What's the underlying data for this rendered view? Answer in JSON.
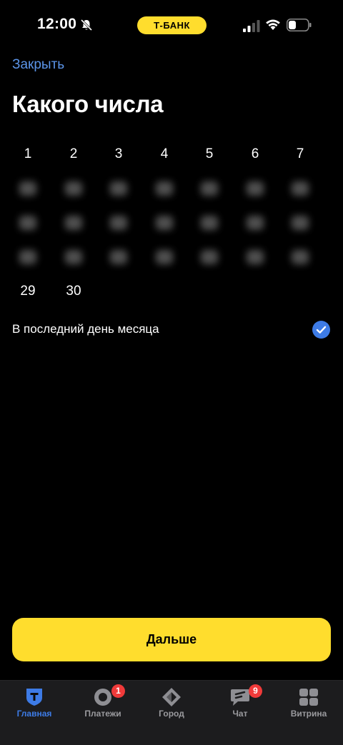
{
  "status_bar": {
    "time": "12:00",
    "carrier": "Т-БАНК",
    "carrier_color": "#ffdd2d"
  },
  "header": {
    "close_label": "Закрыть",
    "title": "Какого числа"
  },
  "calendar": {
    "rows": [
      [
        "1",
        "2",
        "3",
        "4",
        "5",
        "6",
        "7"
      ],
      [
        "",
        "",
        "",
        "",
        "",
        "",
        ""
      ],
      [
        "",
        "",
        "",
        "",
        "",
        "",
        ""
      ],
      [
        "",
        "",
        "",
        "",
        "",
        "",
        ""
      ],
      [
        "29",
        "30"
      ]
    ]
  },
  "last_day_option": {
    "label": "В последний день месяца",
    "checked": true,
    "check_color": "#3d7be6"
  },
  "next_button": {
    "label": "Дальше"
  },
  "tab_bar": {
    "tabs": [
      {
        "label": "Главная",
        "icon": "home-shield-icon",
        "active": true
      },
      {
        "label": "Платежи",
        "icon": "payments-icon",
        "badge": "1"
      },
      {
        "label": "Город",
        "icon": "city-icon"
      },
      {
        "label": "Чат",
        "icon": "chat-icon",
        "badge": "9"
      },
      {
        "label": "Витрина",
        "icon": "showcase-grid-icon"
      }
    ]
  },
  "colors": {
    "accent_blue": "#3d7be6",
    "link_blue": "#5b94e8",
    "brand_yellow": "#ffdd2d",
    "badge_red": "#f03a3a"
  }
}
